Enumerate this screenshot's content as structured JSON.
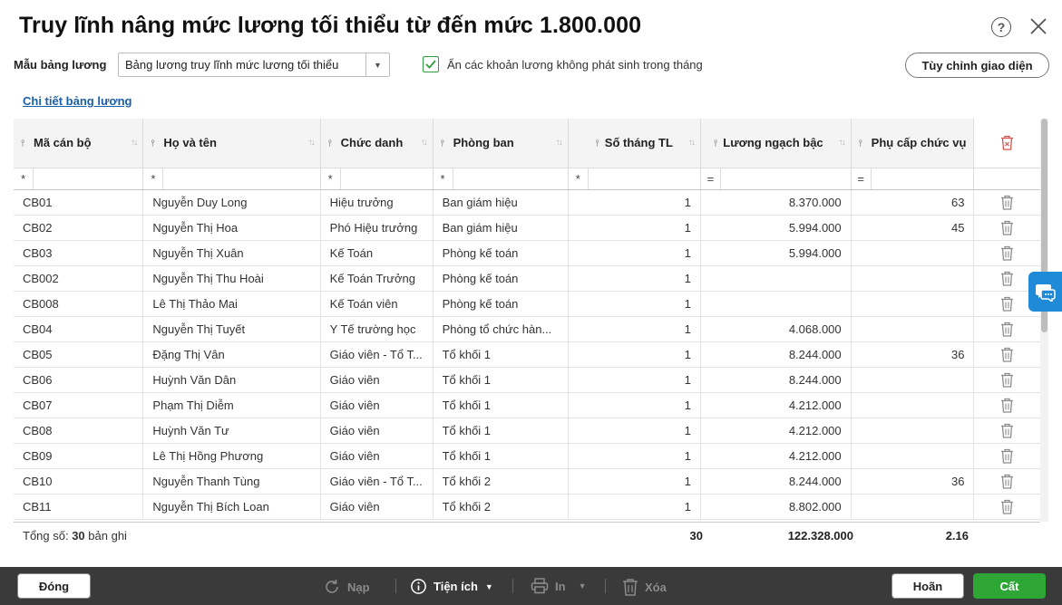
{
  "dialog": {
    "title": "Truy lĩnh nâng mức lương tối thiểu từ đến mức 1.800.000",
    "help_icon": "help-circle-icon",
    "close_icon": "close-icon"
  },
  "options": {
    "template_label": "Mẫu bảng lương",
    "template_value": "Bảng lương truy lĩnh mức lương tối thiểu",
    "hide_checkbox_label": "Ẩn các khoản lương không phát sinh trong tháng",
    "hide_checkbox_checked": true,
    "customize_button": "Tùy chỉnh giao diện",
    "detail_link": "Chi tiết bảng lương"
  },
  "table": {
    "columns": [
      {
        "label": "Mã cán bộ",
        "filter_op": "*"
      },
      {
        "label": "Họ và tên",
        "filter_op": "*"
      },
      {
        "label": "Chức danh",
        "filter_op": "*"
      },
      {
        "label": "Phòng ban",
        "filter_op": "*"
      },
      {
        "label": "Số tháng TL",
        "filter_op": "*"
      },
      {
        "label": "Lương ngạch bậc",
        "filter_op": "="
      },
      {
        "label": "Phụ cấp chức vụ",
        "filter_op": "="
      }
    ],
    "rows": [
      {
        "code": "CB01",
        "name": "Nguyễn Duy Long",
        "title": "Hiệu trưởng",
        "dept": "Ban giám hiệu",
        "months": "1",
        "salary": "8.370.000",
        "allowance": "63"
      },
      {
        "code": "CB02",
        "name": "Nguyễn Thị Hoa",
        "title": "Phó Hiệu trưởng",
        "dept": "Ban giám hiệu",
        "months": "1",
        "salary": "5.994.000",
        "allowance": "45"
      },
      {
        "code": "CB03",
        "name": "Nguyễn Thị Xuân",
        "title": "Kế Toán",
        "dept": "Phòng kế toán",
        "months": "1",
        "salary": "5.994.000",
        "allowance": ""
      },
      {
        "code": "CB002",
        "name": "Nguyễn Thị Thu Hoài",
        "title": "Kế Toán Trưởng",
        "dept": "Phòng kế toán",
        "months": "1",
        "salary": "",
        "allowance": ""
      },
      {
        "code": "CB008",
        "name": "Lê Thị Thảo Mai",
        "title": "Kế Toán viên",
        "dept": "Phòng kế toán",
        "months": "1",
        "salary": "",
        "allowance": ""
      },
      {
        "code": "CB04",
        "name": "Nguyễn Thị Tuyết",
        "title": "Y Tế trường học",
        "dept": "Phòng tổ chức hàn...",
        "months": "1",
        "salary": "4.068.000",
        "allowance": ""
      },
      {
        "code": "CB05",
        "name": "Đặng Thị Vân",
        "title": "Giáo viên - Tổ T...",
        "dept": "Tổ khối 1",
        "months": "1",
        "salary": "8.244.000",
        "allowance": "36"
      },
      {
        "code": "CB06",
        "name": "Huỳnh Văn Dân",
        "title": "Giáo viên",
        "dept": "Tổ khối 1",
        "months": "1",
        "salary": "8.244.000",
        "allowance": ""
      },
      {
        "code": "CB07",
        "name": "Phạm Thị Diễm",
        "title": "Giáo viên",
        "dept": "Tổ khối 1",
        "months": "1",
        "salary": "4.212.000",
        "allowance": ""
      },
      {
        "code": "CB08",
        "name": "Huỳnh Văn Tư",
        "title": "Giáo viên",
        "dept": "Tổ khối 1",
        "months": "1",
        "salary": "4.212.000",
        "allowance": ""
      },
      {
        "code": "CB09",
        "name": "Lê Thị Hồng Phương",
        "title": "Giáo viên",
        "dept": "Tổ khối 1",
        "months": "1",
        "salary": "4.212.000",
        "allowance": ""
      },
      {
        "code": "CB10",
        "name": "Nguyễn Thanh Tùng",
        "title": "Giáo viên - Tổ T...",
        "dept": "Tổ khối 2",
        "months": "1",
        "salary": "8.244.000",
        "allowance": "36"
      },
      {
        "code": "CB11",
        "name": "Nguyễn Thị Bích Loan",
        "title": "Giáo viên",
        "dept": "Tổ khối 2",
        "months": "1",
        "salary": "8.802.000",
        "allowance": ""
      }
    ],
    "footer": {
      "total_prefix": "Tổng số: ",
      "total_count": "30",
      "total_suffix": " bản ghi",
      "sum_months": "30",
      "sum_salary": "122.328.000",
      "sum_allowance": "2.16"
    }
  },
  "toolbar": {
    "close": "Đóng",
    "reload": "Nạp",
    "utilities": "Tiện ích",
    "print": "In",
    "delete": "Xóa",
    "cancel": "Hoãn",
    "save": "Cất"
  },
  "colors": {
    "accent_green": "#2da636",
    "link_blue": "#1a5fa8",
    "toolbar_bg": "#3a3a3a",
    "chat_blue": "#1f8bd8"
  }
}
